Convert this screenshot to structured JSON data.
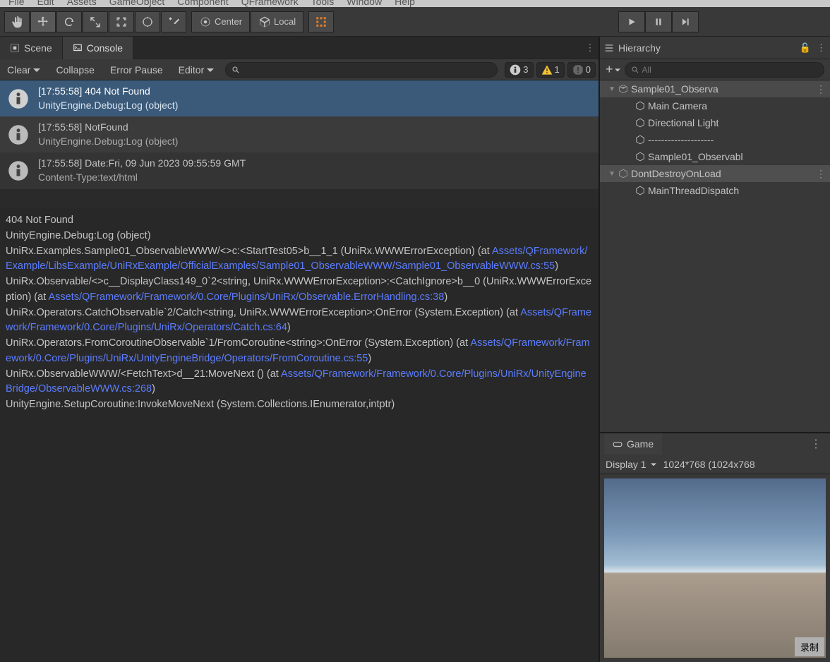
{
  "menu": [
    "File",
    "Edit",
    "Assets",
    "GameObject",
    "Component",
    "QFramework",
    "Tools",
    "Window",
    "Help"
  ],
  "handle": {
    "center": "Center",
    "local": "Local"
  },
  "tabs": {
    "scene": "Scene",
    "console": "Console"
  },
  "console_toolbar": {
    "clear": "Clear",
    "collapse": "Collapse",
    "error_pause": "Error Pause",
    "editor": "Editor"
  },
  "badges": {
    "info": "3",
    "warn": "1",
    "error": "0"
  },
  "logs": [
    {
      "line1": "[17:55:58] 404 Not Found",
      "line2": "UnityEngine.Debug:Log (object)"
    },
    {
      "line1": "[17:55:58] NotFound",
      "line2": "UnityEngine.Debug:Log (object)"
    },
    {
      "line1": "[17:55:58] Date:Fri, 09 Jun 2023 09:55:59 GMT",
      "line2": "Content-Type:text/html"
    }
  ],
  "detail": {
    "t0": "404 Not Found",
    "t1": "UnityEngine.Debug:Log (object)",
    "t2": "UniRx.Examples.Sample01_ObservableWWW/<>c:<StartTest05>b__1_1 (UniRx.WWWErrorException) (at ",
    "l1": "Assets/QFramework/Example/LibsExample/UniRxExample/OfficialExamples/Sample01_ObservableWWW/Sample01_ObservableWWW.cs:55",
    "t3": ")",
    "t4": "UniRx.Observable/<>c__DisplayClass149_0`2<string, UniRx.WWWErrorException>:<CatchIgnore>b__0 (UniRx.WWWErrorException) (at ",
    "l2": "Assets/QFramework/Framework/0.Core/Plugins/UniRx/Observable.ErrorHandling.cs:38",
    "t5": ")",
    "t6": "UniRx.Operators.CatchObservable`2/Catch<string, UniRx.WWWErrorException>:OnError (System.Exception) (at ",
    "l3": "Assets/QFramework/Framework/0.Core/Plugins/UniRx/Operators/Catch.cs:64",
    "t7": ")",
    "t8": "UniRx.Operators.FromCoroutineObservable`1/FromCoroutine<string>:OnError (System.Exception) (at ",
    "l4": "Assets/QFramework/Framework/0.Core/Plugins/UniRx/UnityEngineBridge/Operators/FromCoroutine.cs:55",
    "t9": ")",
    "t10": "UniRx.ObservableWWW/<FetchText>d__21:MoveNext () (at ",
    "l5": "Assets/QFramework/Framework/0.Core/Plugins/UniRx/UnityEngineBridge/ObservableWWW.cs:268",
    "t11": ")",
    "t12": "UnityEngine.SetupCoroutine:InvokeMoveNext (System.Collections.IEnumerator,intptr)"
  },
  "hierarchy": {
    "title": "Hierarchy",
    "search_placeholder": "All",
    "scenes": [
      {
        "name": "Sample01_Observa",
        "items": [
          "Main Camera",
          "Directional Light",
          "--------------------",
          "Sample01_Observabl"
        ]
      },
      {
        "name": "DontDestroyOnLoad",
        "items": [
          "MainThreadDispatch"
        ]
      }
    ]
  },
  "game": {
    "tab": "Game",
    "display": "Display 1",
    "resolution": "1024*768 (1024x768"
  },
  "record": "录制"
}
